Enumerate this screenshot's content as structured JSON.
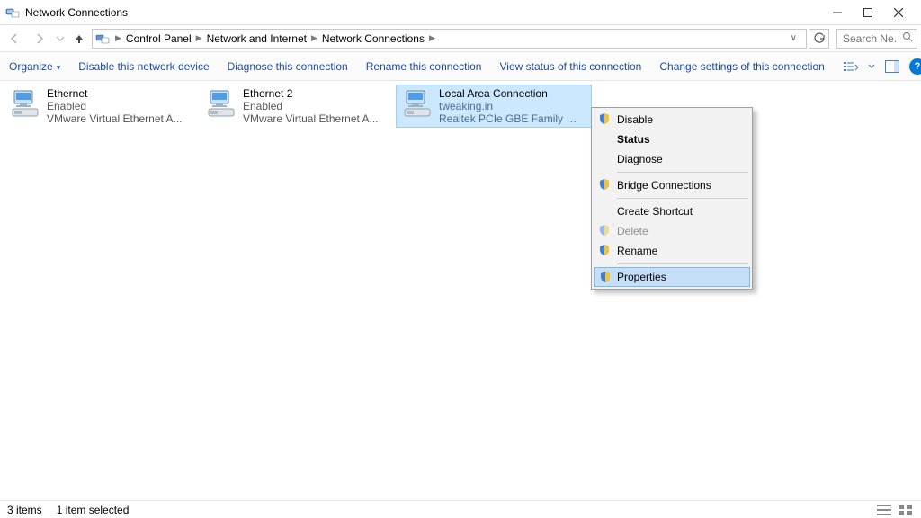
{
  "window": {
    "title": "Network Connections"
  },
  "breadcrumb": {
    "items": [
      "Control Panel",
      "Network and Internet",
      "Network Connections"
    ]
  },
  "search": {
    "placeholder": "Search Ne..."
  },
  "toolbar": {
    "organize": "Organize",
    "disable": "Disable this network device",
    "diagnose": "Diagnose this connection",
    "rename": "Rename this connection",
    "viewstatus": "View status of this connection",
    "change": "Change settings of this connection"
  },
  "connections": [
    {
      "name": "Ethernet",
      "status": "Enabled",
      "desc": "VMware Virtual Ethernet A..."
    },
    {
      "name": "Ethernet 2",
      "status": "Enabled",
      "desc": "VMware Virtual Ethernet A..."
    },
    {
      "name": "Local Area Connection",
      "status": "tweaking.in",
      "desc": "Realtek PCIe GBE Family C..."
    }
  ],
  "context_menu": {
    "disable": "Disable",
    "status": "Status",
    "diagnose": "Diagnose",
    "bridge": "Bridge Connections",
    "shortcut": "Create Shortcut",
    "delete": "Delete",
    "rename": "Rename",
    "properties": "Properties"
  },
  "statusbar": {
    "count": "3 items",
    "selected": "1 item selected"
  }
}
